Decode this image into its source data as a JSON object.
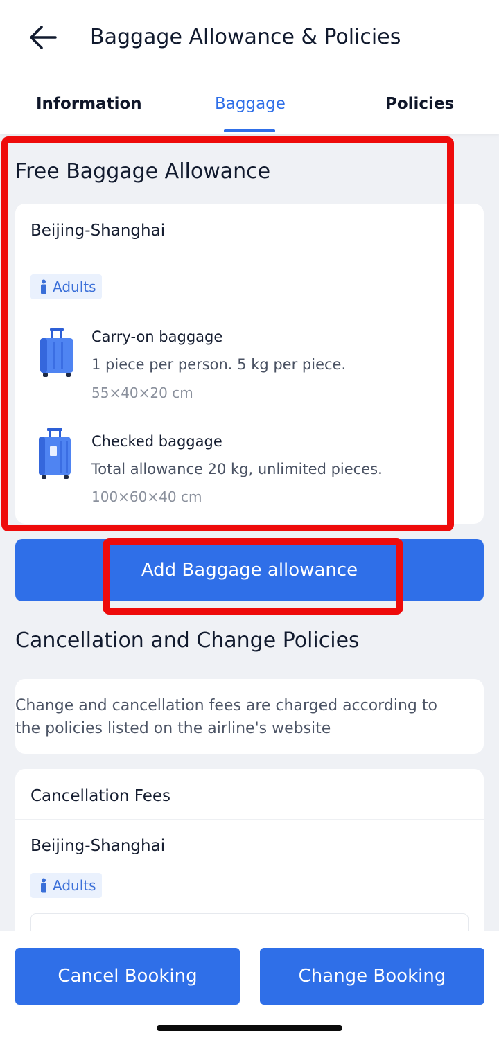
{
  "header": {
    "title": "Baggage Allowance & Policies",
    "back_icon": "arrow-left-icon"
  },
  "tabs": [
    {
      "label": "Information",
      "active": false
    },
    {
      "label": "Baggage",
      "active": true
    },
    {
      "label": "Policies",
      "active": false
    }
  ],
  "baggage": {
    "section_title": "Free Baggage Allowance",
    "route": "Beijing-Shanghai",
    "passenger_type": "Adults",
    "items": [
      {
        "title": "Carry-on baggage",
        "description": "1 piece per person. 5 kg per piece.",
        "dimensions": "55×40×20 cm",
        "icon": "carry-on-suitcase-icon"
      },
      {
        "title": "Checked baggage",
        "description": "Total allowance 20 kg, unlimited pieces.",
        "dimensions": "100×60×40 cm",
        "icon": "checked-suitcase-icon"
      }
    ],
    "add_button_label": "Add Baggage allowance"
  },
  "policies": {
    "section_title": "Cancellation and Change Policies",
    "note": "Change and cancellation fees are charged according to the policies listed on the airline's website",
    "fees_title": "Cancellation Fees",
    "route": "Beijing-Shanghai",
    "passenger_type": "Adults"
  },
  "bottom_bar": {
    "cancel_label": "Cancel Booking",
    "change_label": "Change Booking"
  },
  "colors": {
    "accent": "#2f6fe8",
    "highlight": "#ee0b0b",
    "background": "#eff1f5"
  }
}
